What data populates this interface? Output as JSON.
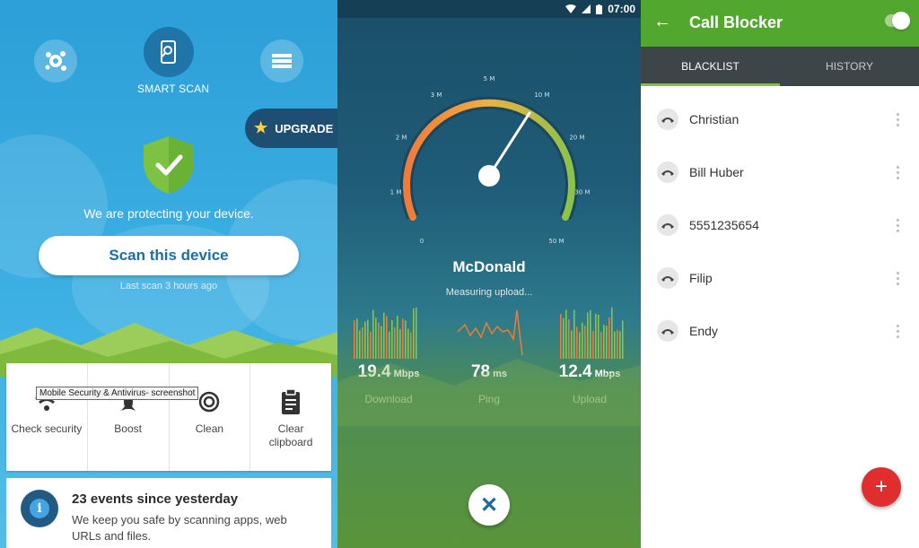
{
  "panel1": {
    "smart_scan_label": "SMART SCAN",
    "upgrade_label": "UPGRADE",
    "protect_text": "We are protecting your device.",
    "scan_button": "Scan this device",
    "last_scan": "Last scan 3 hours ago",
    "tooltip": "Mobile Security & Antivirus- screenshot",
    "actions": [
      {
        "label": "Check security",
        "icon": "wifi-icon"
      },
      {
        "label": "Boost",
        "icon": "rocket-icon"
      },
      {
        "label": "Clean",
        "icon": "broom-icon"
      },
      {
        "label": "Clear clipboard",
        "icon": "clipboard-icon"
      }
    ],
    "events_title": "23 events since yesterday",
    "events_desc": "We keep you safe by scanning apps, web URLs and files.",
    "colors": {
      "accent": "#1d6fa3",
      "shield": "#7dc242"
    }
  },
  "panel2": {
    "status_time": "07:00",
    "gauge_ticks": [
      "0",
      "1 M",
      "2 M",
      "3 M",
      "5 M",
      "10 M",
      "20 M",
      "30 M",
      "50 M"
    ],
    "server_name": "McDonald",
    "status_text": "Measuring upload...",
    "download": {
      "value": "19.4",
      "unit": "Mbps",
      "label": "Download"
    },
    "ping": {
      "value": "78",
      "unit": "ms",
      "label": "Ping"
    },
    "upload": {
      "value": "12.4",
      "unit": "Mbps",
      "label": "Upload"
    },
    "close_symbol": "✕"
  },
  "panel3": {
    "back_symbol": "←",
    "title": "Call Blocker",
    "tabs": [
      "BLACKLIST",
      "HISTORY"
    ],
    "contacts": [
      "Christian",
      "Bill Huber",
      "5551235654",
      "Filip",
      "Endy"
    ],
    "fab_symbol": "+",
    "colors": {
      "header": "#52a72f",
      "tabs": "#3e4548",
      "fab": "#e02d2d"
    }
  }
}
